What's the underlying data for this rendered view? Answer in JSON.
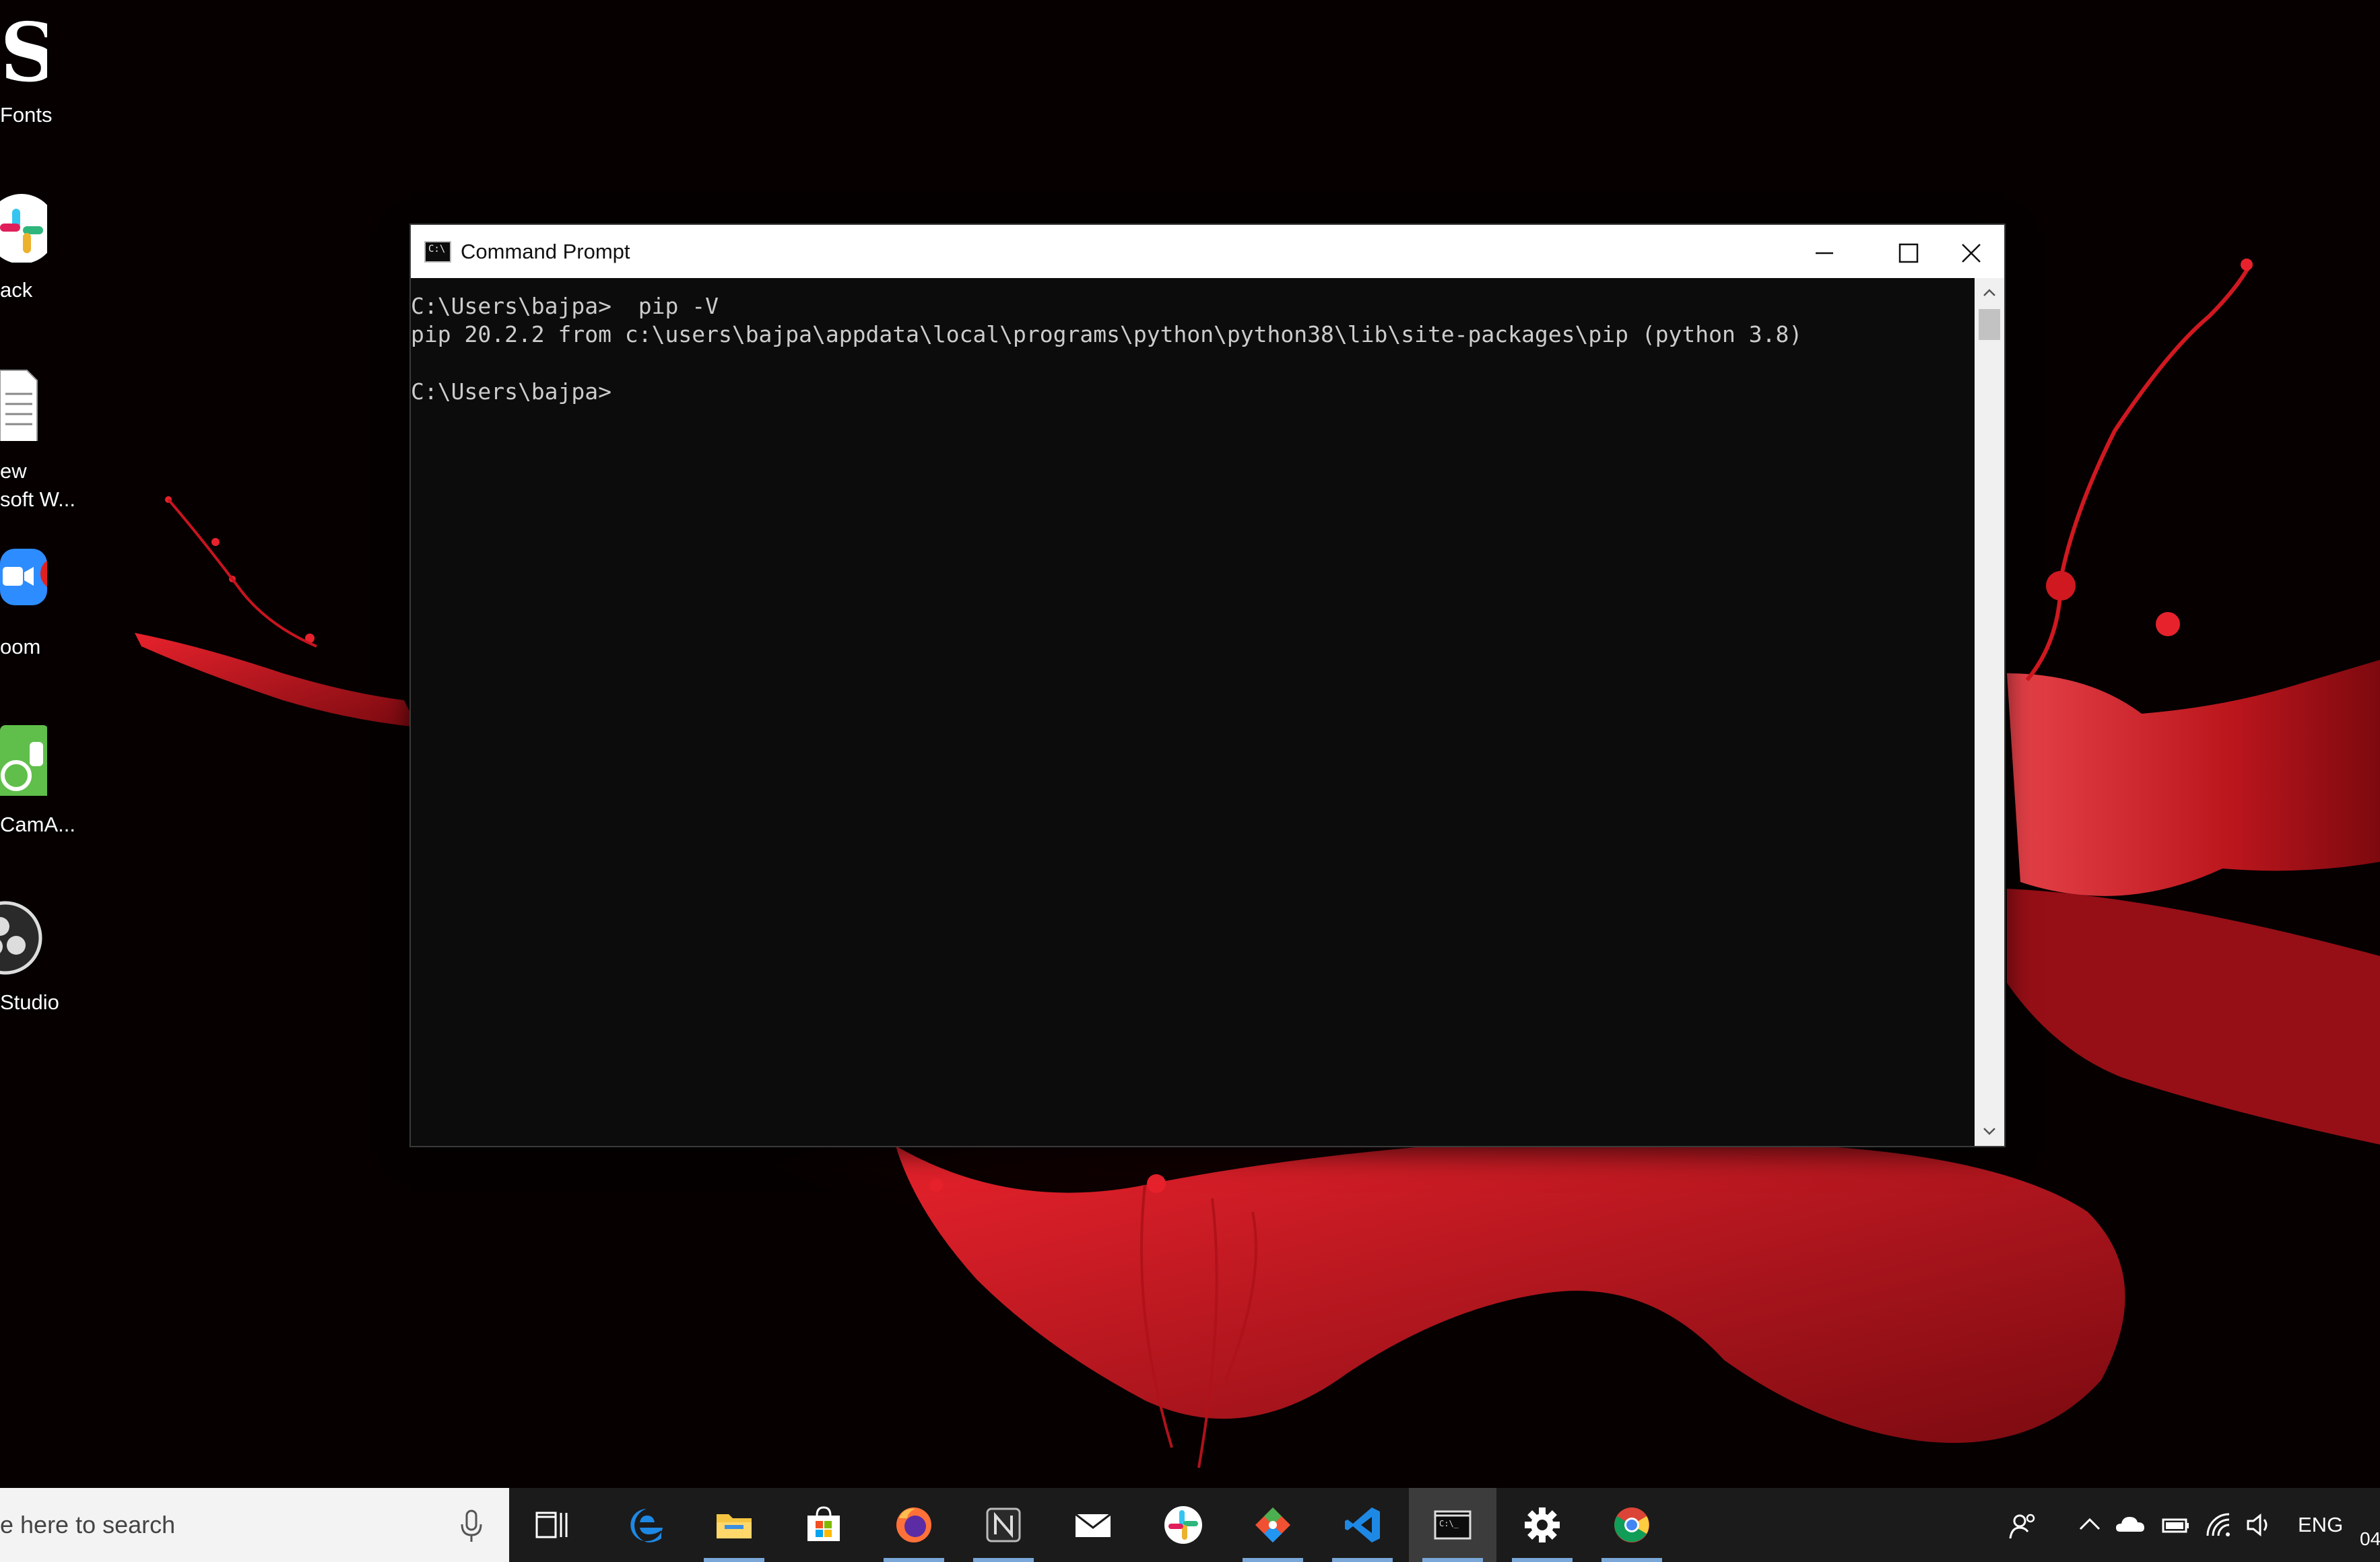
{
  "desktop": {
    "icons": [
      {
        "name": "fonts",
        "label": "Fonts"
      },
      {
        "name": "slack",
        "label": "ack"
      },
      {
        "name": "new-microsoft-word",
        "label_line1": "ew",
        "label_line2": "soft W..."
      },
      {
        "name": "zoom",
        "label": "oom"
      },
      {
        "name": "camapp",
        "label": "CamA..."
      },
      {
        "name": "obs-studio",
        "label": "Studio"
      }
    ]
  },
  "window": {
    "title": "Command Prompt",
    "title_icon_text": "C:\\",
    "console_lines": [
      "C:\\Users\\bajpa>  pip -V",
      "pip 20.2.2 from c:\\users\\bajpa\\appdata\\local\\programs\\python\\python38\\lib\\site-packages\\pip (python 3.8)",
      "",
      "C:\\Users\\bajpa>"
    ]
  },
  "taskbar": {
    "search_placeholder": "e here to search",
    "apps": [
      "task-view",
      "edge",
      "file-explorer",
      "microsoft-store",
      "firefox",
      "notion",
      "mail",
      "slack",
      "git",
      "vscode",
      "command-prompt",
      "settings",
      "chrome"
    ],
    "language": "ENG",
    "clock_fragment": "04"
  },
  "colors": {
    "console_bg": "#0c0c0c",
    "console_text": "#cccccc",
    "taskbar_bg": "#1b1b1b",
    "wallpaper_accent": "#c8141e"
  }
}
